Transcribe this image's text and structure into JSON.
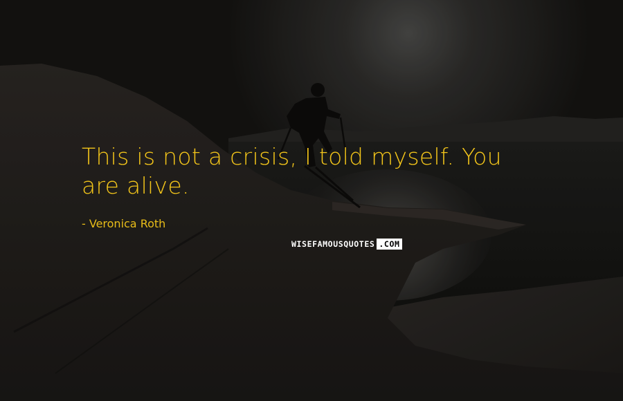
{
  "quote": {
    "text": "This is not a crisis, I told myself. You are alive.",
    "author": "- Veronica Roth"
  },
  "watermark": {
    "main": "WISEFAMOUSQUOTES",
    "tld": ".COM"
  },
  "colors": {
    "quote_text": "#f3c51a",
    "background": "#141311"
  }
}
